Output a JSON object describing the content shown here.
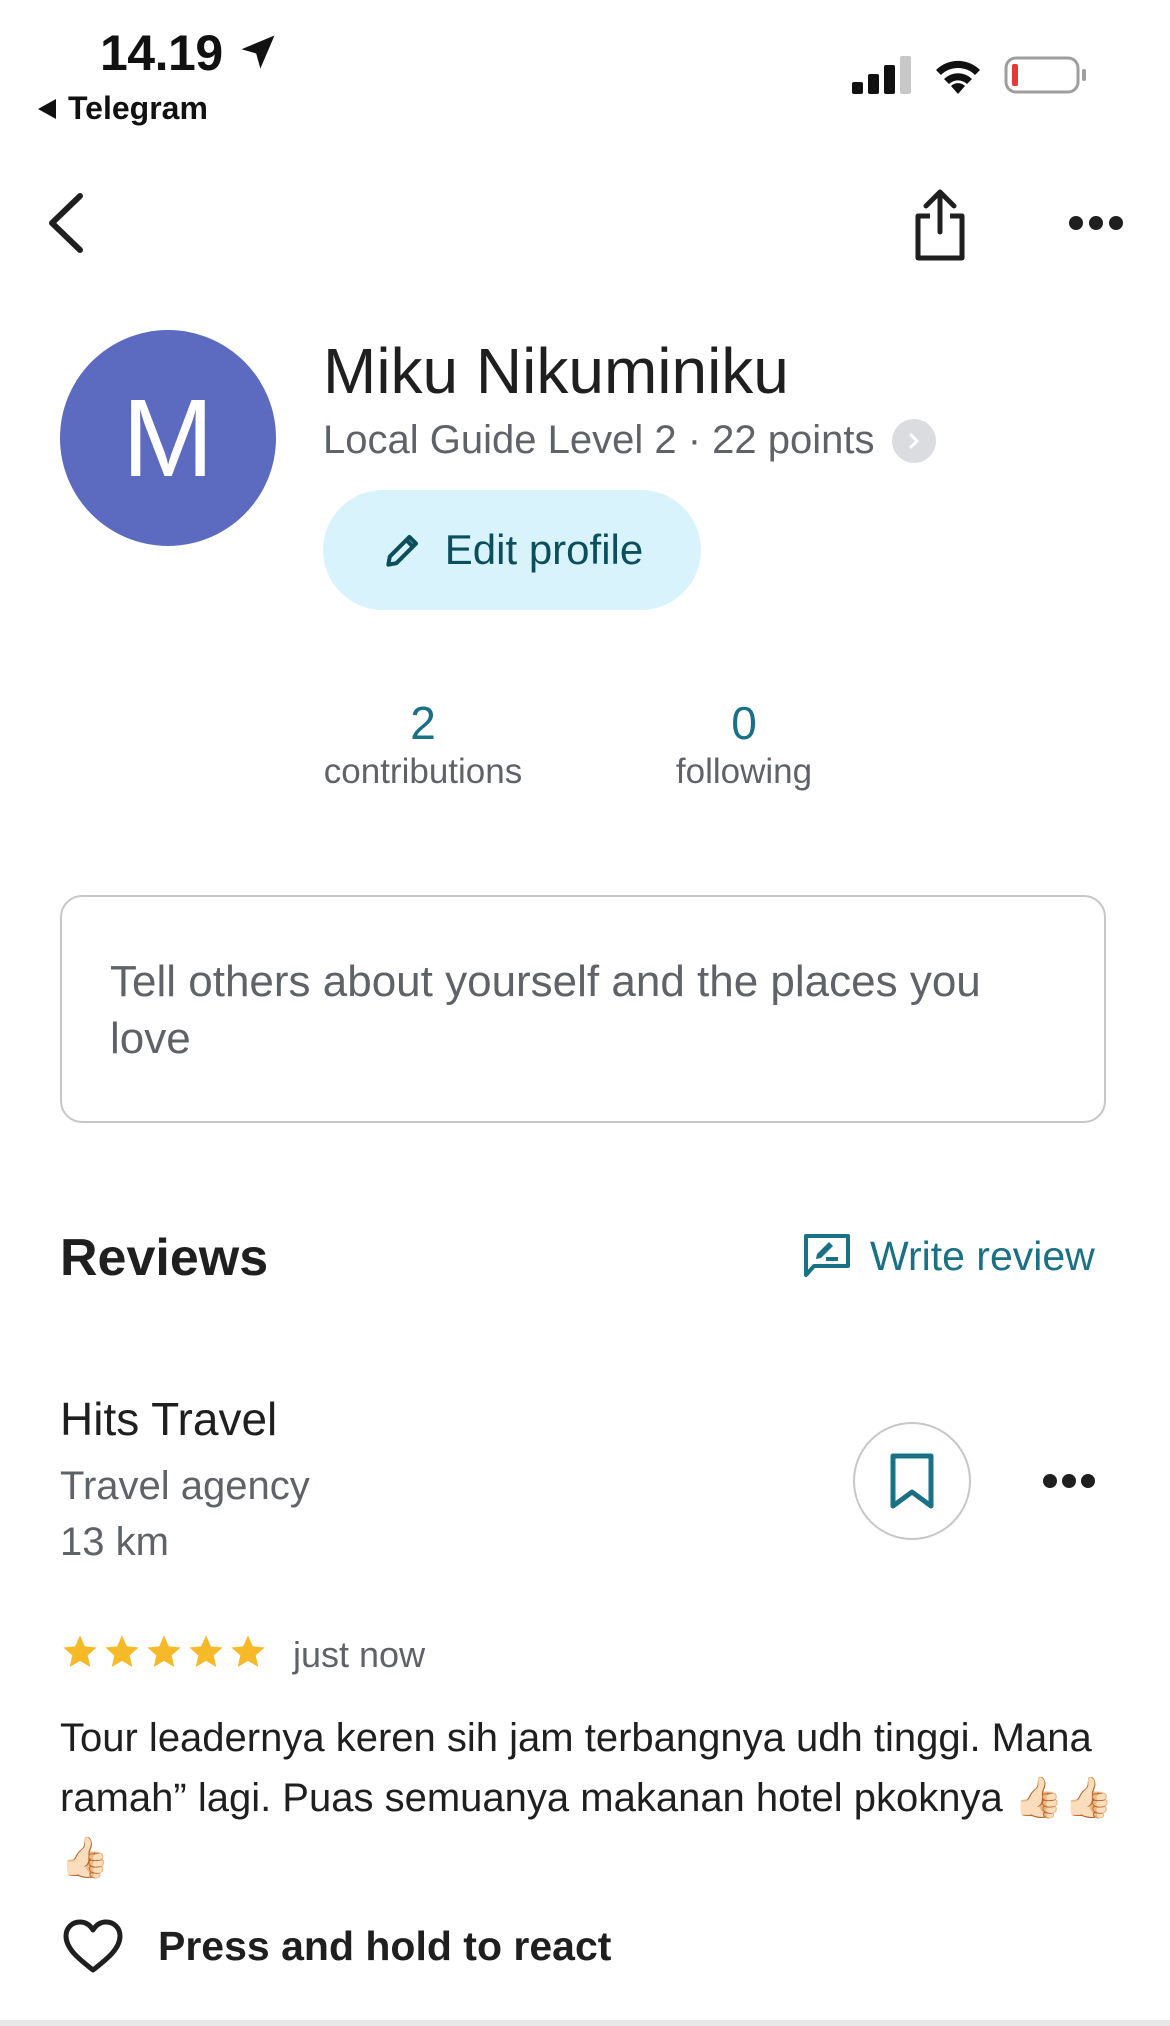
{
  "status_bar": {
    "time": "14.19",
    "back_app": "Telegram"
  },
  "profile": {
    "avatar_letter": "M",
    "avatar_color": "#5c6bc0",
    "name": "Miku Nikuminiku",
    "guide_level": "Local Guide Level 2 · 22 points",
    "edit_button": "Edit profile"
  },
  "stats": {
    "contributions_count": "2",
    "contributions_label": "contributions",
    "following_count": "0",
    "following_label": "following"
  },
  "bio": {
    "placeholder": "Tell others about yourself and the places you love"
  },
  "reviews": {
    "title": "Reviews",
    "write_review": "Write review",
    "items": [
      {
        "place_name": "Hits Travel",
        "place_type": "Travel agency",
        "distance": "13 km",
        "rating": 5,
        "max_rating": 5,
        "time": "just now",
        "text": "Tour leadernya keren sih jam terbangnya udh tinggi. Mana ramah” lagi. Puas semuanya makanan hotel pkoknya 👍🏻👍🏻👍🏻",
        "react_label": "Press and hold to react"
      }
    ]
  },
  "colors": {
    "accent": "#1a7084",
    "edit_button_bg": "#d8f3fb",
    "star": "#f6b928"
  },
  "icons": [
    "location-arrow-icon",
    "signal-icon",
    "wifi-icon",
    "battery-icon",
    "back-arrow-icon",
    "share-icon",
    "more-icon",
    "chevron-right-icon",
    "pencil-icon",
    "write-review-icon",
    "bookmark-icon",
    "star-icon",
    "heart-icon"
  ]
}
